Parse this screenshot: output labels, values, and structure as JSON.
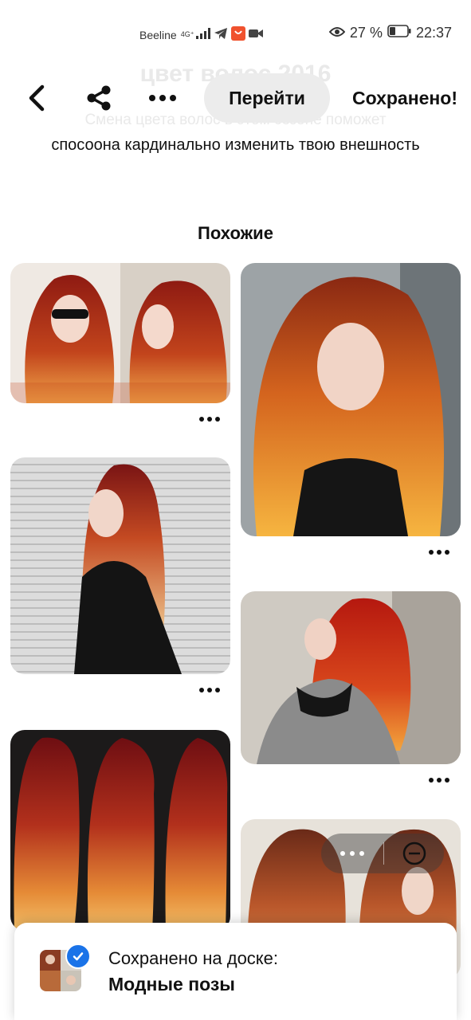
{
  "status_bar": {
    "carrier": "Beeline",
    "network": "4G⁺",
    "battery_percent": "27 %",
    "time": "22:37",
    "icons": [
      "signal-icon",
      "telegram-icon",
      "aliexpress-icon",
      "video-icon",
      "eye-icon",
      "battery-icon"
    ]
  },
  "faded_text": {
    "title": "цвет волос 2016",
    "subtitle": "Смена цвета волос в этом сезоне поможет"
  },
  "header": {
    "back_icon": "back-arrow-icon",
    "share_icon": "share-icon",
    "more_icon": "more-dots-icon",
    "goto_label": "Перейти",
    "saved_label": "Сохранено!"
  },
  "pin": {
    "description": "спосоона кардинально изменить твою внешность"
  },
  "similar": {
    "title": "Похожие",
    "pins": [
      {
        "name": "pin-1",
        "theme": "red-ombre-two-photos"
      },
      {
        "name": "pin-2",
        "theme": "copper-wavy-hair"
      },
      {
        "name": "pin-3",
        "theme": "red-blonde-ombre-leather-jacket"
      },
      {
        "name": "pin-4",
        "theme": "red-hair-grey-sweater"
      },
      {
        "name": "pin-5",
        "theme": "red-ombre-straight-hair-three-views"
      },
      {
        "name": "pin-6",
        "theme": "copper-waves-two-views"
      }
    ]
  },
  "toast": {
    "line1": "Сохранено на доске:",
    "line2": "Модные позы"
  },
  "colors": {
    "goto_button_bg": "#ececec",
    "check_badge": "#1a73e8",
    "text": "#111111"
  }
}
